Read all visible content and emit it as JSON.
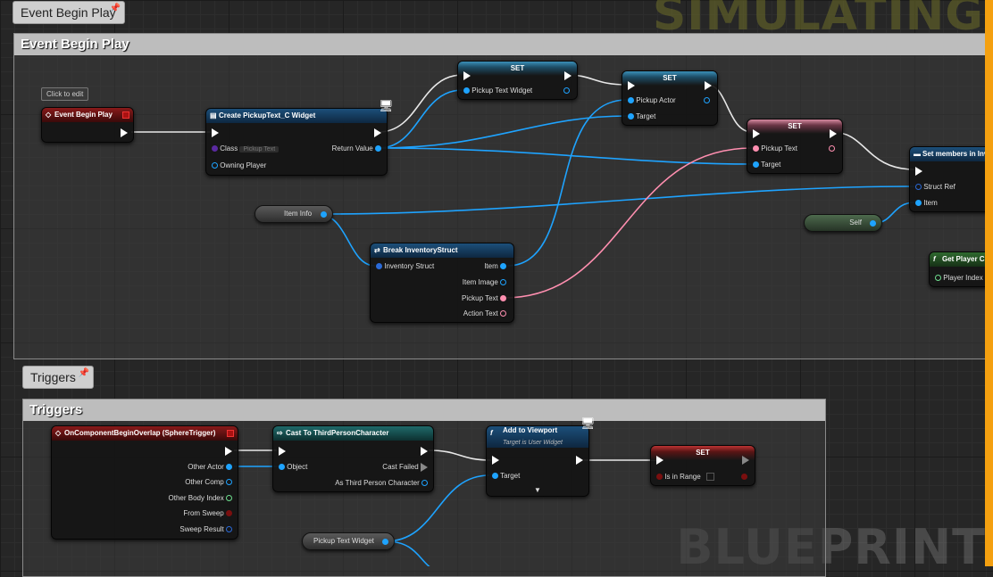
{
  "watermark": {
    "top": "SIMULATING",
    "bottom": "BLUEPRINT"
  },
  "tabs": {
    "event": "Event Begin Play",
    "triggers": "Triggers"
  },
  "comments": {
    "event": "Event Begin Play",
    "triggers": "Triggers"
  },
  "click_to_edit": "Click to edit",
  "event_begin_play": {
    "title": "Event Begin Play"
  },
  "create_widget": {
    "title": "Create PickupText_C Widget",
    "class_label": "Class",
    "class_value": "Pickup Text",
    "return_value": "Return Value",
    "owning_player": "Owning Player"
  },
  "set1": {
    "title": "SET",
    "pin": "Pickup Text Widget"
  },
  "set2": {
    "title": "SET",
    "pin": "Pickup Actor",
    "target": "Target"
  },
  "set3": {
    "title": "SET",
    "pin": "Pickup Text",
    "target": "Target"
  },
  "set_members": {
    "title": "Set members in Inv",
    "struct_ref": "Struct Ref",
    "item": "Item"
  },
  "item_info": {
    "label": "Item Info"
  },
  "self_node": {
    "label": "Self"
  },
  "break_struct": {
    "title": "Break InventoryStruct",
    "input": "Inventory Struct",
    "item": "Item",
    "item_image": "Item Image",
    "pickup_text": "Pickup Text",
    "action_text": "Action Text"
  },
  "get_player": {
    "title": "Get Player C",
    "player_index": "Player Index"
  },
  "overlap": {
    "title": "OnComponentBeginOverlap (SphereTrigger)",
    "pins": [
      "Other Actor",
      "Other Comp",
      "Other Body Index",
      "From Sweep",
      "Sweep Result"
    ]
  },
  "cast": {
    "title": "Cast To ThirdPersonCharacter",
    "object": "Object",
    "cast_failed": "Cast Failed",
    "as_tpc": "As Third Person Character"
  },
  "add_viewport": {
    "title": "Add to Viewport",
    "subtitle": "Target is User Widget",
    "target": "Target"
  },
  "set4": {
    "title": "SET",
    "pin": "Is in Range"
  },
  "pickup_widget_var": {
    "label": "Pickup Text Widget"
  }
}
